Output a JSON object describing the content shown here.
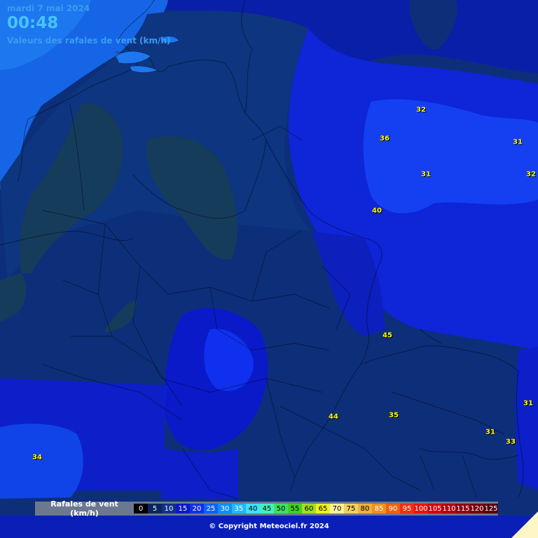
{
  "header": {
    "date": "mardi 7 mai 2024",
    "time": "00:48",
    "subtitle": "Valeurs des rafales de vent (km/h)"
  },
  "values": [
    {
      "label": "32"
    },
    {
      "label": "36"
    },
    {
      "label": "31"
    },
    {
      "label": "31"
    },
    {
      "label": "32"
    },
    {
      "label": "40"
    },
    {
      "label": "45"
    },
    {
      "label": "31"
    },
    {
      "label": "44"
    },
    {
      "label": "35"
    },
    {
      "label": "31"
    },
    {
      "label": "33"
    },
    {
      "label": "34"
    }
  ],
  "legend": {
    "title": "Rafales de vent (km/h)",
    "steps": [
      {
        "label": "0",
        "color": "#000000",
        "text": "#ffffff"
      },
      {
        "label": "5",
        "color": "#0a2460",
        "text": "#ffffff"
      },
      {
        "label": "10",
        "color": "#10308a",
        "text": "#ffffff"
      },
      {
        "label": "15",
        "color": "#0a18c8",
        "text": "#ffffff"
      },
      {
        "label": "20",
        "color": "#1230e6",
        "text": "#ffffff"
      },
      {
        "label": "25",
        "color": "#1060ff",
        "text": "#ffffff"
      },
      {
        "label": "30",
        "color": "#0a90ff",
        "text": "#ffffff"
      },
      {
        "label": "35",
        "color": "#20b8ff",
        "text": "#ffffff"
      },
      {
        "label": "40",
        "color": "#40e0ff",
        "text": "#000000"
      },
      {
        "label": "45",
        "color": "#40f0c0",
        "text": "#000000"
      },
      {
        "label": "50",
        "color": "#40e060",
        "text": "#000000"
      },
      {
        "label": "55",
        "color": "#40d020",
        "text": "#000000"
      },
      {
        "label": "60",
        "color": "#a0e020",
        "text": "#000000"
      },
      {
        "label": "65",
        "color": "#f0f020",
        "text": "#000000"
      },
      {
        "label": "70",
        "color": "#fff0a0",
        "text": "#000000"
      },
      {
        "label": "75",
        "color": "#f0d060",
        "text": "#000000"
      },
      {
        "label": "80",
        "color": "#f0b040",
        "text": "#000000"
      },
      {
        "label": "85",
        "color": "#f09020",
        "text": "#ffffff"
      },
      {
        "label": "90",
        "color": "#f06010",
        "text": "#ffffff"
      },
      {
        "label": "95",
        "color": "#f03010",
        "text": "#ffffff"
      },
      {
        "label": "100",
        "color": "#f01010",
        "text": "#ffffff"
      },
      {
        "label": "105",
        "color": "#d00010",
        "text": "#ffffff"
      },
      {
        "label": "110",
        "color": "#b00010",
        "text": "#ffffff"
      },
      {
        "label": "115",
        "color": "#900010",
        "text": "#ffffff"
      },
      {
        "label": "120",
        "color": "#700010",
        "text": "#ffffff"
      },
      {
        "label": "125",
        "color": "#500010",
        "text": "#ffffff"
      }
    ]
  },
  "copyright": "© Copyright Meteociel.fr 2024"
}
